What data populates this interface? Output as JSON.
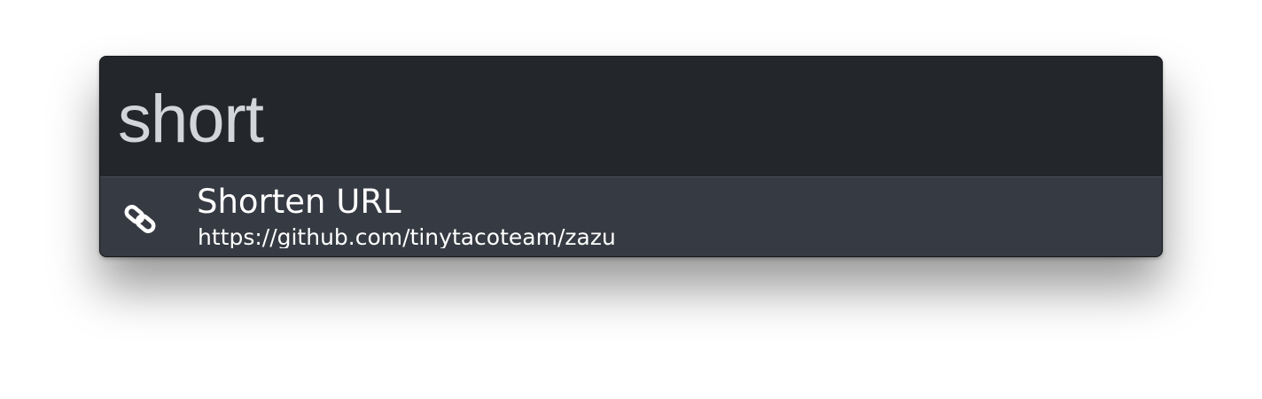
{
  "search": {
    "query": "short"
  },
  "results": [
    {
      "icon": "link-icon",
      "title": "Shorten URL",
      "subtitle": "https://github.com/tinytacoteam/zazu"
    }
  ],
  "colors": {
    "background": "#23262b",
    "result_background": "#363a42",
    "divider": "#4a4f57",
    "query_text": "#d2d5da",
    "result_text": "#ffffff"
  }
}
